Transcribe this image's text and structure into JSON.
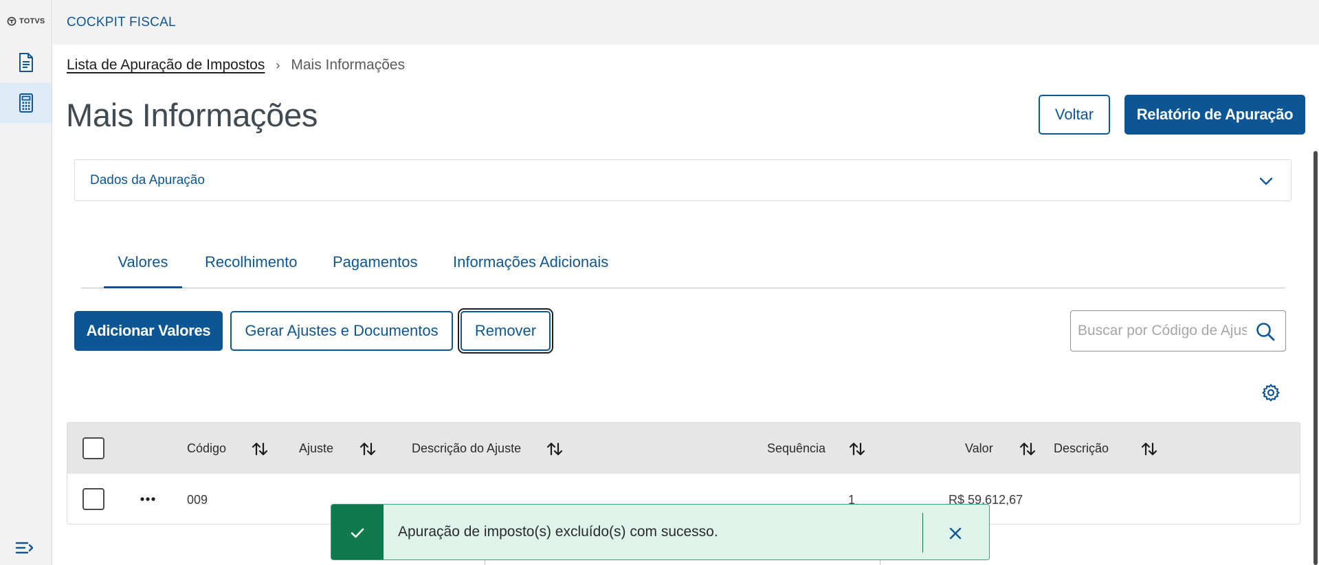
{
  "sidebar": {
    "logo_text": "TOTVS",
    "items": [
      {
        "name": "documents",
        "icon": "document-icon",
        "active": false
      },
      {
        "name": "calculator",
        "icon": "calculator-icon",
        "active": true
      }
    ],
    "menu_icon": "collapse-menu-icon"
  },
  "header": {
    "app_title": "COCKPIT FISCAL"
  },
  "breadcrumb": {
    "parent": "Lista de Apuração de Impostos",
    "separator": "›",
    "current": "Mais Informações"
  },
  "page": {
    "title": "Mais Informações",
    "back_label": "Voltar",
    "report_label": "Relatório de Apuração"
  },
  "accordion": {
    "label": "Dados da Apuração",
    "expanded": false
  },
  "tabs": [
    {
      "label": "Valores",
      "active": true
    },
    {
      "label": "Recolhimento",
      "active": false
    },
    {
      "label": "Pagamentos",
      "active": false
    },
    {
      "label": "Informações Adicionais",
      "active": false
    }
  ],
  "actions": {
    "add_label": "Adicionar Valores",
    "generate_label": "Gerar Ajustes e Documentos",
    "remove_label": "Remover"
  },
  "search": {
    "placeholder": "Buscar por Código de Ajuste",
    "value": ""
  },
  "table": {
    "columns": [
      "Código",
      "Ajuste",
      "Descrição do Ajuste",
      "Sequência",
      "Valor",
      "Descrição"
    ],
    "rows": [
      {
        "codigo": "009",
        "ajuste": "",
        "descricao_ajuste": "",
        "sequencia": "1",
        "valor": "R$ 59.612,67",
        "descricao": "",
        "more_icon": "more-horizontal-icon"
      }
    ]
  },
  "toast": {
    "type": "success",
    "message": "Apuração de imposto(s) excluído(s) com sucesso."
  },
  "colors": {
    "primary": "#0c5696",
    "success": "#107a4e",
    "success_bg": "#def4eb",
    "sidebar_bg": "#f2f2f2",
    "sidebar_active": "#dcebf6"
  }
}
